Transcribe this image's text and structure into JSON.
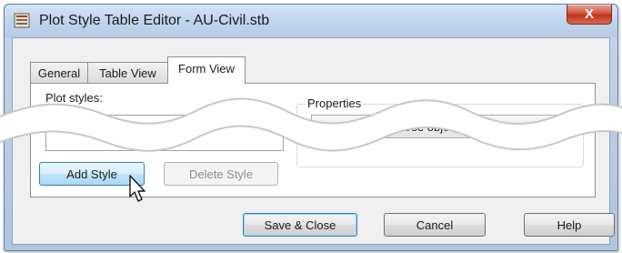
{
  "window": {
    "title": "Plot Style Table Editor - AU-Civil.stb",
    "close_glyph": "X"
  },
  "tabs": [
    {
      "label": "General",
      "active": false
    },
    {
      "label": "Table View",
      "active": false
    },
    {
      "label": "Form View",
      "active": true
    }
  ],
  "form_view": {
    "plot_styles_label": "Plot styles:",
    "properties_label": "Properties",
    "color_value": "Use object color",
    "add_style_label": "Add Style",
    "delete_style_label": "Delete Style"
  },
  "footer": {
    "save_close_label": "Save & Close",
    "cancel_label": "Cancel",
    "help_label": "Help"
  },
  "icons": [
    "app-icon",
    "close-icon",
    "dropdown-arrow-icon",
    "mouse-pointer-icon"
  ],
  "colors": {
    "close_button": "#c2321a",
    "default_button_border": "#3c7fb1"
  }
}
